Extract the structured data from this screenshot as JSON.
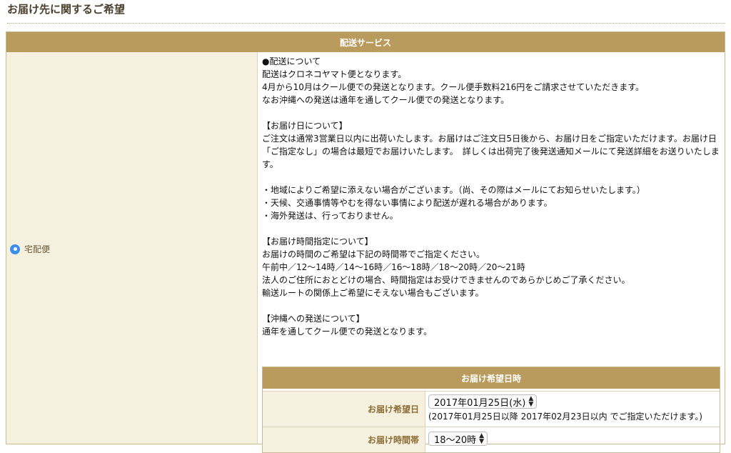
{
  "section_title": "お届け先に関するご希望",
  "table": {
    "header": "配送サービス",
    "service": {
      "label": "宅配便",
      "selected": true
    },
    "info_lines": [
      "●配送について",
      "配送はクロネコヤマト便となります。",
      "4月から10月はクール便での発送となります。クール便手数料216円をご請求させていただきます。",
      "なお沖縄への発送は通年を通してクール便での発送となります。",
      "",
      "【お届け日について】",
      "ご注文は通常3営業日以内に出荷いたします。お届けはご注文日5日後から、お届け日をご指定いただけます。お届け日「ご指定なし」の場合は最短でお届けいたします。　詳しくは出荷完了後発送通知メールにて発送詳細をお送りいたします。",
      "",
      "・地域によりご希望に添えない場合がございます。（尚、その際はメールにてお知らせいたします。）",
      "・天候、交通事情等やむを得ない事情により配送が遅れる場合があります。",
      "・海外発送は、行っておりません。",
      "",
      "【お届け時間指定について】",
      "お届けの時間のご希望は下記の時間帯でご指定ください。",
      "午前中／12〜14時／14〜16時／16〜18時／18〜20時／20〜21時",
      "法人のご住所におとどけの場合、時間指定はお受けできませんのであらかじめご了承ください。",
      "輸送ルートの関係上ご希望にそえない場合もございます。",
      "",
      "【沖縄への発送について】",
      "通年を通してクール便での発送となります。"
    ],
    "delivery": {
      "header": "お届け希望日時",
      "date_label": "お届け希望日",
      "date_value": "2017年01月25日(水)",
      "date_note": "(2017年01月25日以降 2017年02月23日以内 でご指定いただけます。)",
      "time_label": "お届け時間帯",
      "time_value": "18〜20時"
    }
  },
  "colors": {
    "header_bg": "#b89b5d",
    "label_bg": "#f6f1df",
    "label_text": "#8b6b33",
    "radio": "#3b8eea"
  },
  "icons": {
    "radio": "radio-selected-icon",
    "select_arrows": "up-down-arrows-icon"
  }
}
